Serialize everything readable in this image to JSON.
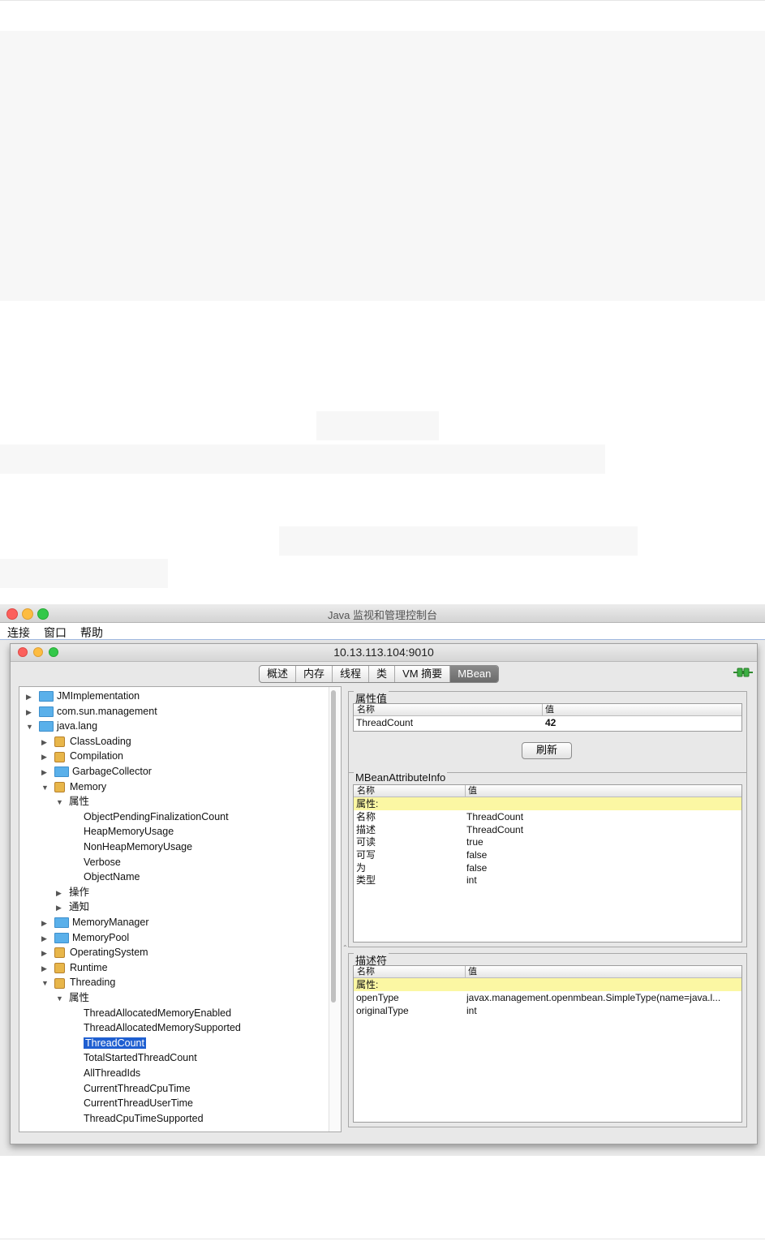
{
  "window": {
    "title": "Java 监视和管理控制台"
  },
  "menubar": [
    "连接",
    "窗口",
    "帮助"
  ],
  "connection": {
    "title": "10.13.113.104:9010"
  },
  "tabs": [
    {
      "label": "概述",
      "selected": false
    },
    {
      "label": "内存",
      "selected": false
    },
    {
      "label": "线程",
      "selected": false
    },
    {
      "label": "类",
      "selected": false
    },
    {
      "label": "VM 摘要",
      "selected": false
    },
    {
      "label": "MBean",
      "selected": true
    }
  ],
  "tree": [
    {
      "label": "JMImplementation",
      "level": 0,
      "expander": "collapsed",
      "icon": "folder-icon"
    },
    {
      "label": "com.sun.management",
      "level": 0,
      "expander": "collapsed",
      "icon": "folder-icon"
    },
    {
      "label": "java.lang",
      "level": 0,
      "expander": "expanded",
      "icon": "folder-icon"
    },
    {
      "label": "ClassLoading",
      "level": 1,
      "expander": "collapsed",
      "icon": "bean-icon"
    },
    {
      "label": "Compilation",
      "level": 1,
      "expander": "collapsed",
      "icon": "bean-icon"
    },
    {
      "label": "GarbageCollector",
      "level": 1,
      "expander": "collapsed",
      "icon": "folder-icon"
    },
    {
      "label": "Memory",
      "level": 1,
      "expander": "expanded",
      "icon": "bean-icon"
    },
    {
      "label": "属性",
      "level": 2,
      "expander": "expanded",
      "icon": ""
    },
    {
      "label": "ObjectPendingFinalizationCount",
      "level": 3,
      "expander": "none",
      "icon": ""
    },
    {
      "label": "HeapMemoryUsage",
      "level": 3,
      "expander": "none",
      "icon": ""
    },
    {
      "label": "NonHeapMemoryUsage",
      "level": 3,
      "expander": "none",
      "icon": ""
    },
    {
      "label": "Verbose",
      "level": 3,
      "expander": "none",
      "icon": ""
    },
    {
      "label": "ObjectName",
      "level": 3,
      "expander": "none",
      "icon": ""
    },
    {
      "label": "操作",
      "level": 2,
      "expander": "collapsed",
      "icon": ""
    },
    {
      "label": "通知",
      "level": 2,
      "expander": "collapsed",
      "icon": ""
    },
    {
      "label": "MemoryManager",
      "level": 1,
      "expander": "collapsed",
      "icon": "folder-icon"
    },
    {
      "label": "MemoryPool",
      "level": 1,
      "expander": "collapsed",
      "icon": "folder-icon"
    },
    {
      "label": "OperatingSystem",
      "level": 1,
      "expander": "collapsed",
      "icon": "bean-icon"
    },
    {
      "label": "Runtime",
      "level": 1,
      "expander": "collapsed",
      "icon": "bean-icon"
    },
    {
      "label": "Threading",
      "level": 1,
      "expander": "expanded",
      "icon": "bean-icon"
    },
    {
      "label": "属性",
      "level": 2,
      "expander": "expanded",
      "icon": ""
    },
    {
      "label": "ThreadAllocatedMemoryEnabled",
      "level": 3,
      "expander": "none",
      "icon": ""
    },
    {
      "label": "ThreadAllocatedMemorySupported",
      "level": 3,
      "expander": "none",
      "icon": ""
    },
    {
      "label": "ThreadCount",
      "level": 3,
      "expander": "none",
      "icon": "",
      "selected": true
    },
    {
      "label": "TotalStartedThreadCount",
      "level": 3,
      "expander": "none",
      "icon": ""
    },
    {
      "label": "AllThreadIds",
      "level": 3,
      "expander": "none",
      "icon": ""
    },
    {
      "label": "CurrentThreadCpuTime",
      "level": 3,
      "expander": "none",
      "icon": ""
    },
    {
      "label": "CurrentThreadUserTime",
      "level": 3,
      "expander": "none",
      "icon": ""
    },
    {
      "label": "ThreadCpuTimeSupported",
      "level": 3,
      "expander": "none",
      "icon": ""
    }
  ],
  "attr_values": {
    "title": "属性值",
    "headers": [
      "名称",
      "值"
    ],
    "rows": [
      {
        "name": "ThreadCount",
        "value": "42"
      }
    ],
    "refresh_label": "刷新"
  },
  "attr_info": {
    "title": "MBeanAttributeInfo",
    "headers": [
      "名称",
      "值"
    ],
    "section": "属性:",
    "rows": [
      {
        "name": "名称",
        "value": "ThreadCount"
      },
      {
        "name": "描述",
        "value": "ThreadCount"
      },
      {
        "name": "可读",
        "value": "true"
      },
      {
        "name": "可写",
        "value": "false"
      },
      {
        "name": "为",
        "value": "false"
      },
      {
        "name": "类型",
        "value": "int"
      }
    ]
  },
  "descriptor": {
    "title": "描述符",
    "headers": [
      "名称",
      "值"
    ],
    "section": "属性:",
    "rows": [
      {
        "name": "openType",
        "value": "javax.management.openmbean.SimpleType(name=java.l..."
      },
      {
        "name": "originalType",
        "value": "int"
      }
    ]
  },
  "colors": {
    "selection": "#1f5fd1",
    "highlight_row": "#fbf7a3",
    "folder": "#5ab0ea"
  }
}
